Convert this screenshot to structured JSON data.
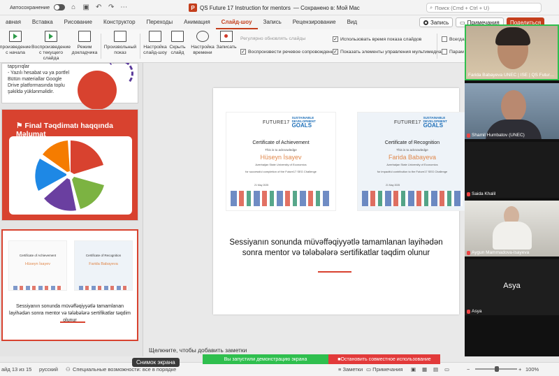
{
  "titlebar": {
    "autosave_label": "Автосохранение",
    "doc_title": "QS Future 17 Instruction for mentors",
    "saved_status": "— Сохранено в: Мой Mac",
    "search_placeholder": "Поиск (Cmd + Ctrl + U)"
  },
  "tabs": [
    {
      "label": "авная"
    },
    {
      "label": "Вставка"
    },
    {
      "label": "Рисование"
    },
    {
      "label": "Конструктор"
    },
    {
      "label": "Переходы"
    },
    {
      "label": "Анимация"
    },
    {
      "label": "Слайд-шоу"
    },
    {
      "label": "Запись"
    },
    {
      "label": "Рецензирование"
    },
    {
      "label": "Вид"
    }
  ],
  "tab_actions": {
    "record": "Запись",
    "comments": "Примечания",
    "share": "Поделиться"
  },
  "ribbon": {
    "from_start": "произведение с начала",
    "from_current": "Воспроизведение с текущего слайда",
    "presenter": "Режим докладчика",
    "custom_show": "Произвольный показ",
    "setup": "Настройка слайд-шоу",
    "hide": "Скрыть слайд",
    "rehearse": "Настройка времени",
    "record": "Записать",
    "update_slides": "Регулярно обновлять слайды",
    "play_narration": "Воспроизвести речевое сопровождение",
    "use_timings": "Использовать время показа слайдов",
    "show_media_controls": "Показать элементы управления мультимедиа",
    "always": "Всегда",
    "params": "Парам"
  },
  "thumbnails": {
    "t1_text": "- Yazılı hesabat və ya portfel Bütün materiallar Google Drive platformasında toplu şəkildə yüklənməlidir.",
    "t1_prefix": "tapşırıqlar",
    "t2_title": "Final Təqdimatı haqqında Məlumat",
    "t3_caption": "Sessiyanın sonunda müvəffəqiyyətlə tamamlanan layihədən sonra mentor və tələbələrə sertifikatlar təqdim olunur",
    "t3_cert_left_title": "Certificate of Achievement",
    "t3_cert_left_name": "Hüseyn İsayev",
    "t3_cert_right_title": "Certificate of Recognition",
    "t3_cert_right_name": "Farida Babayeva"
  },
  "slide": {
    "cert_left": {
      "future": "FUTURE17",
      "sdg_line1": "SUSTAINABLE",
      "sdg_line2": "DEVELOPMENT",
      "goals": "GOALS",
      "title": "Certificate of Achievement",
      "ack": "This is to acknowledge",
      "name": "Hüseyn İsayev",
      "university": "Azerbaijan State University of Economics",
      "for": "for successful completion of the Future17 SEG Challenge",
      "date": "21 May 2025"
    },
    "cert_right": {
      "future": "FUTURE17",
      "sdg_line1": "SUSTAINABLE",
      "sdg_line2": "DEVELOPMENT",
      "goals": "GOALS",
      "title": "Certificate of Recognition",
      "ack": "This is to acknowledge",
      "name": "Farida Babayeva",
      "university": "Azerbaijan State University of Economics",
      "for": "for impactful contribution to the Future17 SEG Challenge",
      "date": "21 May 2025"
    },
    "caption": "Sessiyanın sonunda müvəffəqiyyətlə tamamlanan layihədən sonra mentor və tələbələrə sertifikatlar təqdim olunur"
  },
  "notes_placeholder": "Щелкните, чтобы добавить заметки",
  "participants": [
    {
      "name": "Farida Babayeva UNEC | ISE | QS Futur…"
    },
    {
      "name": "Shamil Humbatov (UNEC)"
    },
    {
      "name": "Saida Khalil"
    },
    {
      "name": "Aygun Mammadova-Isayeva"
    },
    {
      "name": "Asya",
      "big_name": "Asya"
    }
  ],
  "status": {
    "slide_counter": "айд 13 из 15",
    "language": "русский",
    "accessibility": "Специальные возможности: все в порядке",
    "notes": "Заметки",
    "comments": "Примечания",
    "zoom": "100%"
  },
  "screen_share": {
    "status": "Вы запустили демонстрацию экрана",
    "stop": "Остановить совместное использование"
  },
  "tooltip": "Снимок экрана",
  "colors": {
    "accent": "#c43e1c",
    "slide_red": "#d8422f",
    "share_green": "#2fbf4e",
    "share_red": "#e23a3a"
  }
}
